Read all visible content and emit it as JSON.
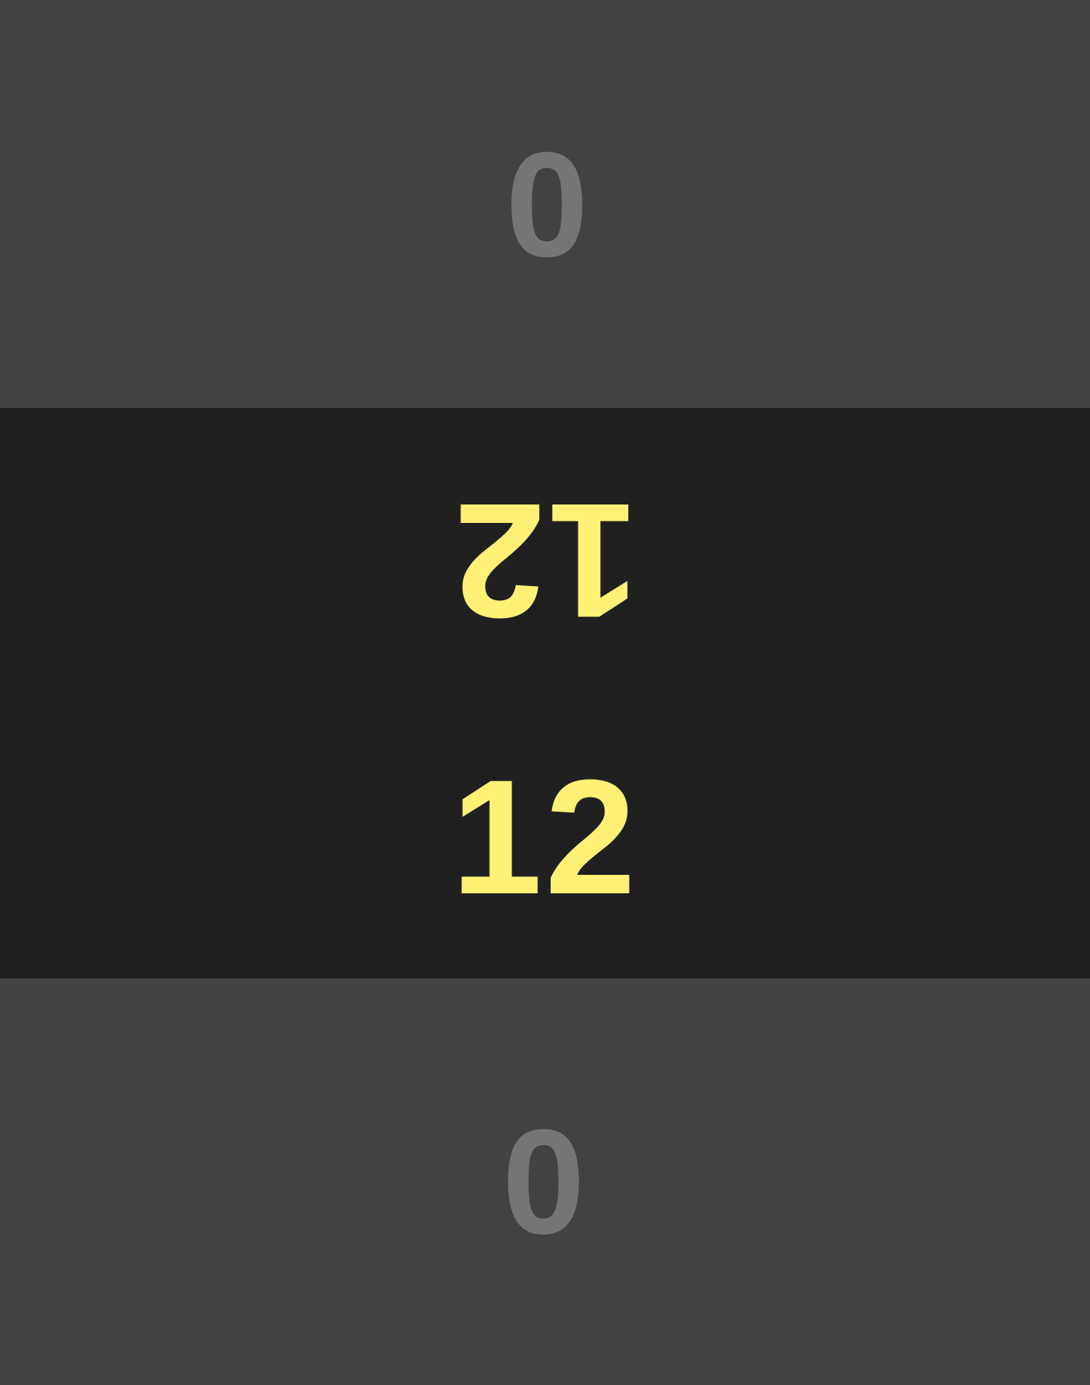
{
  "colors": {
    "inactive_bg": "#424242",
    "active_bg": "#202020",
    "inactive_text": "#757575",
    "active_text": "#fff176"
  },
  "top_panel": {
    "score": "0"
  },
  "middle_panel": {
    "score_flipped": "12",
    "score_upright": "12"
  },
  "bottom_panel": {
    "score": "0"
  }
}
